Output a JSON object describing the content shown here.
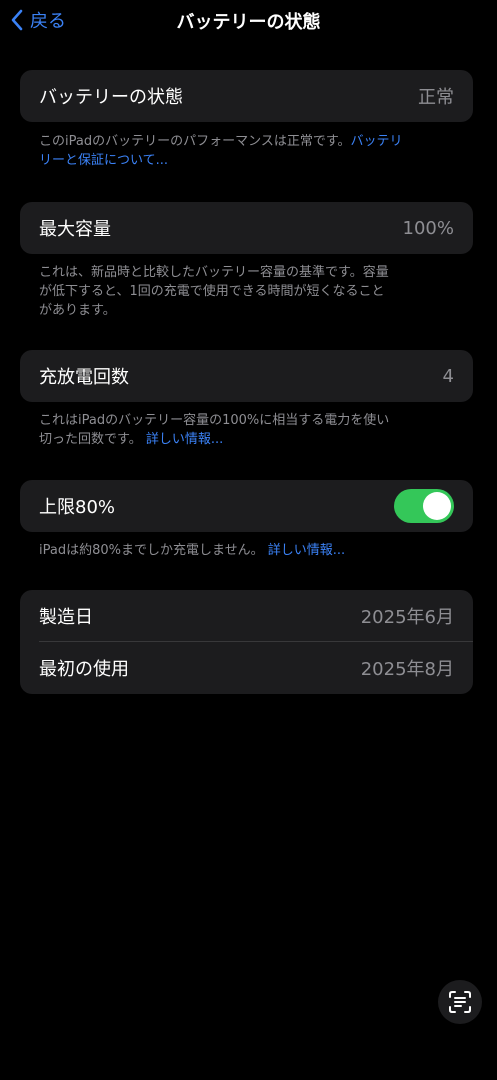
{
  "nav": {
    "back_label": "戻る",
    "title": "バッテリーの状態"
  },
  "health": {
    "label": "バッテリーの状態",
    "value": "正常",
    "footer_text": "このiPadのバッテリーのパフォーマンスは正常です。",
    "footer_link_line1": "バッテリ",
    "footer_link_line2": "リーと保証について..."
  },
  "capacity": {
    "label": "最大容量",
    "value": "100%",
    "footer_line1": "これは、新品時と比較したバッテリー容量の基準です。容量",
    "footer_line2": "が低下すると、1回の充電で使用できる時間が短くなること",
    "footer_line3": "があります。"
  },
  "cycles": {
    "label": "充放電回数",
    "value": "4",
    "footer_line1": "これはiPadのバッテリー容量の100%に相当する電力を使い",
    "footer_line2": "切った回数です。",
    "footer_link": "詳しい情報..."
  },
  "limit": {
    "label": "上限80%",
    "enabled": true,
    "footer_text": "iPadは約80%までしか充電しません。",
    "footer_link": "詳しい情報..."
  },
  "dates": {
    "manufacture_label": "製造日",
    "manufacture_value": "2025年6月",
    "first_use_label": "最初の使用",
    "first_use_value": "2025年8月"
  },
  "colors": {
    "accent": "#3b82f6",
    "toggle_on": "#34c759",
    "card_bg": "#1c1c1e",
    "secondary_text": "#8e8e93"
  },
  "icons": {
    "back": "chevron-left-icon",
    "scan": "text-scan-icon"
  }
}
